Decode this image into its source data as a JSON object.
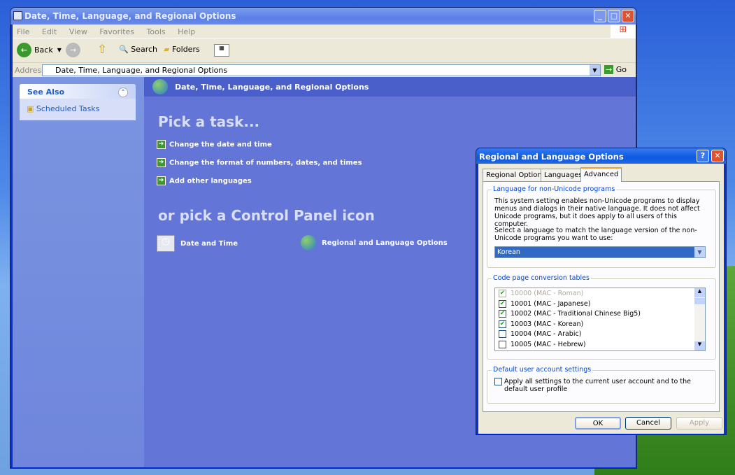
{
  "explorer": {
    "title": "Date, Time, Language, and Regional Options",
    "menu": [
      "File",
      "Edit",
      "View",
      "Favorites",
      "Tools",
      "Help"
    ],
    "toolbar": {
      "back": "Back",
      "search": "Search",
      "folders": "Folders"
    },
    "address": {
      "label": "Address",
      "value": "Date, Time, Language, and Regional Options",
      "go": "Go"
    },
    "see_also": {
      "title": "See Also",
      "items": [
        "Scheduled Tasks"
      ]
    },
    "header": "Date, Time, Language, and Regional Options",
    "pick_task": "Pick a task...",
    "tasks": [
      "Change the date and time",
      "Change the format of numbers, dates, and times",
      "Add other languages"
    ],
    "pick_icon": "or pick a Control Panel icon",
    "icons": [
      "Date and Time",
      "Regional and Language Options"
    ]
  },
  "dialog": {
    "title": "Regional and Language Options",
    "tabs": [
      "Regional Options",
      "Languages",
      "Advanced"
    ],
    "active_tab": "Advanced",
    "group1": {
      "label": "Language for non-Unicode programs",
      "text1": "This system setting enables non-Unicode programs to display menus and dialogs in their native language. It does not affect Unicode programs, but it does apply to all users of this computer.",
      "text2": "Select a language to match the language version of the non-Unicode programs you want to use:",
      "selected": "Korean"
    },
    "group2": {
      "label": "Code page conversion tables",
      "items": [
        {
          "label": "10000 (MAC - Roman)",
          "checked": true,
          "disabled": true
        },
        {
          "label": "10001 (MAC - Japanese)",
          "checked": true
        },
        {
          "label": "10002 (MAC - Traditional Chinese Big5)",
          "checked": true
        },
        {
          "label": "10003 (MAC - Korean)",
          "checked": true
        },
        {
          "label": "10004 (MAC - Arabic)",
          "checked": false
        },
        {
          "label": "10005 (MAC - Hebrew)",
          "checked": false
        }
      ]
    },
    "group3": {
      "label": "Default user account settings",
      "checkbox": "Apply all settings to the current user account and to the default user profile",
      "checked": false
    },
    "buttons": {
      "ok": "OK",
      "cancel": "Cancel",
      "apply": "Apply"
    }
  }
}
